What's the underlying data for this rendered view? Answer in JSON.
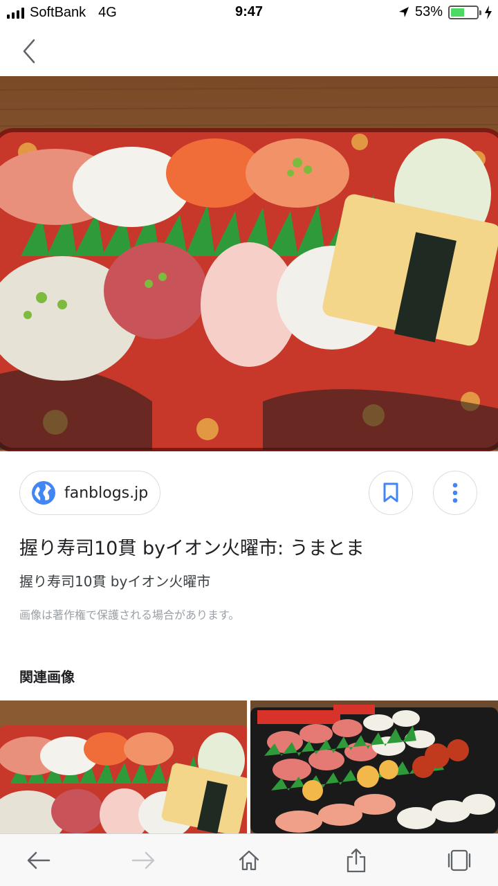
{
  "status_bar": {
    "carrier": "SoftBank",
    "network": "4G",
    "time": "9:47",
    "battery_percent": "53%",
    "battery_level": 0.53,
    "icons": [
      "signal-icon",
      "location-icon",
      "battery-icon",
      "charging-icon"
    ]
  },
  "nav": {
    "back_icon": "chevron-left-icon"
  },
  "result": {
    "source": "fanblogs.jp",
    "source_icon": "globe-icon",
    "bookmark_icon": "bookmark-icon",
    "more_icon": "more-vert-icon",
    "title": "握り寿司10貫 byイオン火曜市: うまとま",
    "subtitle": "握り寿司10貫 byイオン火曜市",
    "copyright_notice": "画像は著作権で保護される場合があります。"
  },
  "related": {
    "heading": "関連画像"
  },
  "toolbar": {
    "icons": [
      "back-arrow-icon",
      "forward-arrow-icon",
      "home-icon",
      "share-icon",
      "tabs-icon"
    ]
  },
  "colors": {
    "accent_blue": "#4285f4",
    "battery_green": "#4cd964",
    "tray_red": "#c8382a"
  }
}
